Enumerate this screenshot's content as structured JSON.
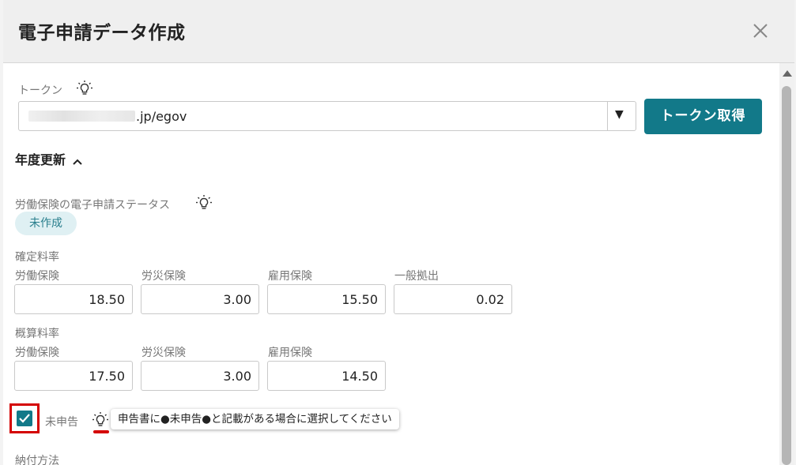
{
  "dialog": {
    "title": "電子申請データ作成"
  },
  "token": {
    "label": "トークン",
    "value": ".jp/egov",
    "dropdown_arrow": "▼",
    "button_label": "トークン取得"
  },
  "annual_update": {
    "label": "年度更新"
  },
  "status": {
    "label": "労働保険の電子申請ステータス",
    "value": "未作成"
  },
  "fixed_rate": {
    "label": "確定料率",
    "fields": [
      {
        "label": "労働保険",
        "value": "18.50"
      },
      {
        "label": "労災保険",
        "value": "3.00"
      },
      {
        "label": "雇用保険",
        "value": "15.50"
      },
      {
        "label": "一般拠出",
        "value": "0.02"
      }
    ]
  },
  "estimated_rate": {
    "label": "概算料率",
    "fields": [
      {
        "label": "労働保険",
        "value": "17.50"
      },
      {
        "label": "労災保険",
        "value": "3.00"
      },
      {
        "label": "雇用保険",
        "value": "14.50"
      }
    ]
  },
  "unfiled": {
    "label": "未申告",
    "checked": true,
    "tooltip": "申告書に●未申告●と記載がある場合に選択してください"
  },
  "payment": {
    "label": "納付方法"
  },
  "icons": {
    "close": "close-icon",
    "hint": "lightbulb-icon",
    "chevron": "chevron-up-icon",
    "check": "check-icon"
  },
  "colors": {
    "accent": "#127989",
    "chip_bg": "#dff0f3",
    "highlight": "#d40000"
  }
}
